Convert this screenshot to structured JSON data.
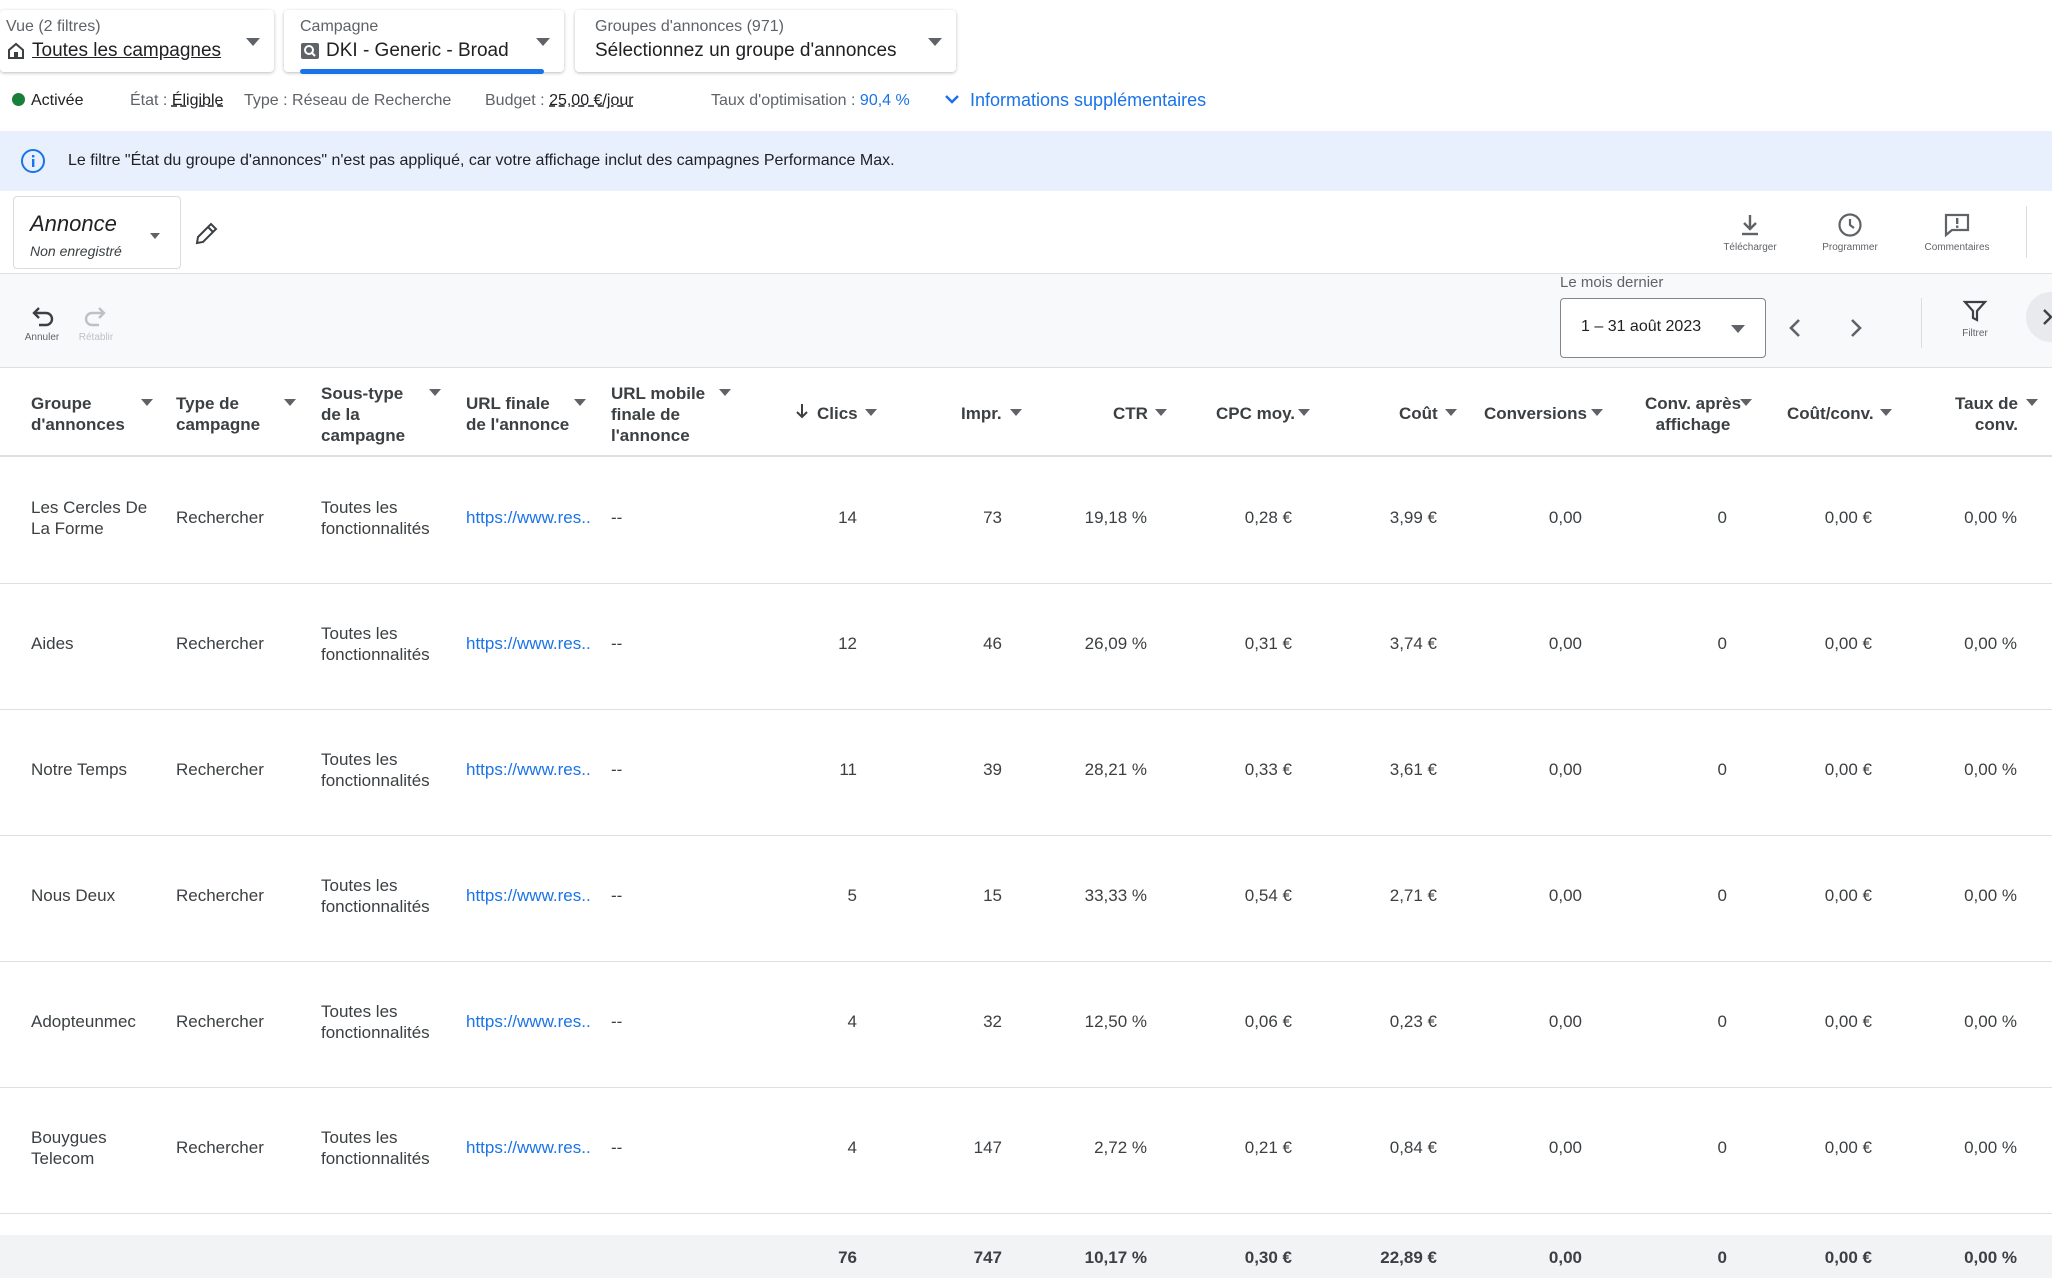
{
  "pickers": {
    "view": {
      "label": "Vue (2 filtres)",
      "value": "Toutes les campagnes"
    },
    "campaign": {
      "label": "Campagne",
      "value": "DKI - Generic - Broad"
    },
    "adgroups": {
      "label": "Groupes d'annonces (971)",
      "value": "Sélectionnez un groupe d'annonces"
    }
  },
  "status": {
    "state": "Activée",
    "etat_label": "État :",
    "etat_value": "Éligible",
    "type": "Type : Réseau de Recherche",
    "budget_label": "Budget :",
    "budget_value": "25,00 €/jour",
    "optim_label": "Taux d'optimisation :",
    "optim_value": "90,4 %",
    "more_info": "Informations supplémentaires",
    "active_color": "#188038"
  },
  "banner": {
    "text": "Le filtre \"État du groupe d'annonces\" n'est pas appliqué, car votre affichage inclut des campagnes Performance Max."
  },
  "view_selector": {
    "title": "Annonce",
    "subtitle": "Non enregistré"
  },
  "tools": {
    "download": "Télécharger",
    "schedule": "Programmer",
    "comments": "Commentaires",
    "undo": "Annuler",
    "redo": "Rétablir",
    "filter": "Filtrer"
  },
  "date": {
    "label": "Le mois dernier",
    "range": "1 – 31 août 2023"
  },
  "columns": {
    "adgroup": [
      "Groupe",
      "d'annonces"
    ],
    "camptype": [
      "Type de",
      "campagne"
    ],
    "subtype": [
      "Sous-type",
      "de la",
      "campagne"
    ],
    "finalurl": [
      "URL finale",
      "de l'annonce"
    ],
    "mobileurl": [
      "URL mobile",
      "finale de",
      "l'annonce"
    ],
    "clicks": "Clics",
    "impr": "Impr.",
    "ctr": "CTR",
    "cpc": "CPC moy.",
    "cost": "Coût",
    "conv": "Conversions",
    "viewconv": [
      "Conv. après",
      "affichage"
    ],
    "costconv": "Coût/conv.",
    "convrate": [
      "Taux de",
      "conv."
    ]
  },
  "rows": [
    {
      "adgroup": [
        "Les Cercles De",
        "La Forme"
      ],
      "camptype": "Rechercher",
      "subtype": [
        "Toutes les",
        "fonctionnalités"
      ],
      "url": "https://www.res..",
      "mobile": "--",
      "clicks": "14",
      "impr": "73",
      "ctr": "19,18 %",
      "cpc": "0,28 €",
      "cost": "3,99 €",
      "conv": "0,00",
      "viewconv": "0",
      "costconv": "0,00 €",
      "convrate": "0,00 %"
    },
    {
      "adgroup": [
        "Aides"
      ],
      "camptype": "Rechercher",
      "subtype": [
        "Toutes les",
        "fonctionnalités"
      ],
      "url": "https://www.res..",
      "mobile": "--",
      "clicks": "12",
      "impr": "46",
      "ctr": "26,09 %",
      "cpc": "0,31 €",
      "cost": "3,74 €",
      "conv": "0,00",
      "viewconv": "0",
      "costconv": "0,00 €",
      "convrate": "0,00 %"
    },
    {
      "adgroup": [
        "Notre Temps"
      ],
      "camptype": "Rechercher",
      "subtype": [
        "Toutes les",
        "fonctionnalités"
      ],
      "url": "https://www.res..",
      "mobile": "--",
      "clicks": "11",
      "impr": "39",
      "ctr": "28,21 %",
      "cpc": "0,33 €",
      "cost": "3,61 €",
      "conv": "0,00",
      "viewconv": "0",
      "costconv": "0,00 €",
      "convrate": "0,00 %"
    },
    {
      "adgroup": [
        "Nous Deux"
      ],
      "camptype": "Rechercher",
      "subtype": [
        "Toutes les",
        "fonctionnalités"
      ],
      "url": "https://www.res..",
      "mobile": "--",
      "clicks": "5",
      "impr": "15",
      "ctr": "33,33 %",
      "cpc": "0,54 €",
      "cost": "2,71 €",
      "conv": "0,00",
      "viewconv": "0",
      "costconv": "0,00 €",
      "convrate": "0,00 %"
    },
    {
      "adgroup": [
        "Adopteunmec"
      ],
      "camptype": "Rechercher",
      "subtype": [
        "Toutes les",
        "fonctionnalités"
      ],
      "url": "https://www.res..",
      "mobile": "--",
      "clicks": "4",
      "impr": "32",
      "ctr": "12,50 %",
      "cpc": "0,06 €",
      "cost": "0,23 €",
      "conv": "0,00",
      "viewconv": "0",
      "costconv": "0,00 €",
      "convrate": "0,00 %"
    },
    {
      "adgroup": [
        "Bouygues",
        "Telecom"
      ],
      "camptype": "Rechercher",
      "subtype": [
        "Toutes les",
        "fonctionnalités"
      ],
      "url": "https://www.res..",
      "mobile": "--",
      "clicks": "4",
      "impr": "147",
      "ctr": "2,72 %",
      "cpc": "0,21 €",
      "cost": "0,84 €",
      "conv": "0,00",
      "viewconv": "0",
      "costconv": "0,00 €",
      "convrate": "0,00 %"
    }
  ],
  "totals": {
    "clicks": "76",
    "impr": "747",
    "ctr": "10,17 %",
    "cpc": "0,30 €",
    "cost": "22,89 €",
    "conv": "0,00",
    "viewconv": "0",
    "costconv": "0,00 €",
    "convrate": "0,00 %"
  }
}
